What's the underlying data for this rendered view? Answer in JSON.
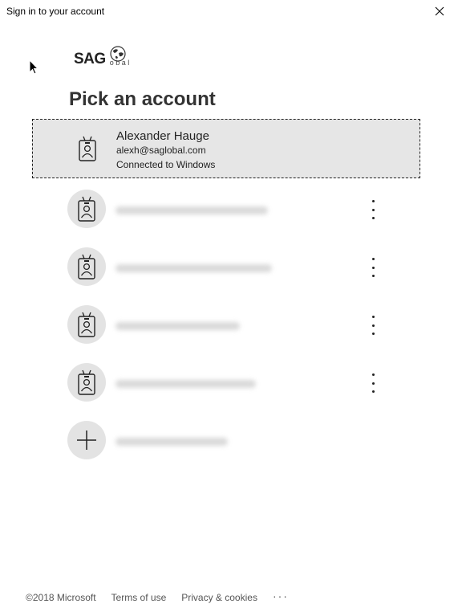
{
  "window": {
    "title": "Sign in to your account"
  },
  "logo": {
    "text": "SAG",
    "sub": "obal"
  },
  "page": {
    "heading": "Pick an account"
  },
  "selected_account": {
    "name": "Alexander Hauge",
    "email": "alexh@saglobal.com",
    "status": "Connected to Windows"
  },
  "other_accounts": {
    "count": 4,
    "note": "blurred"
  },
  "footer": {
    "copyright": "©2018 Microsoft",
    "terms": "Terms of use",
    "privacy": "Privacy & cookies",
    "more": "···"
  },
  "icons": {
    "avatar": "id-badge-icon",
    "add": "plus-icon",
    "more": "vertical-ellipsis-icon",
    "close": "close-icon"
  }
}
